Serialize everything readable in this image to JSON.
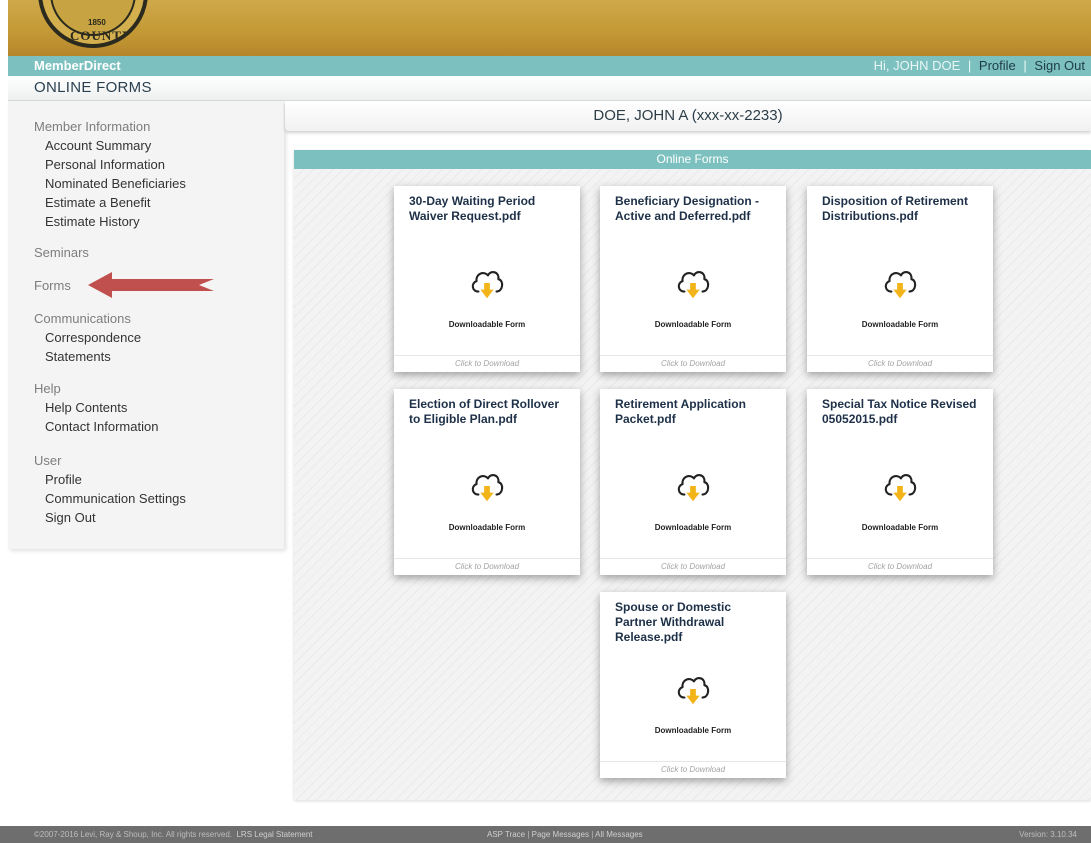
{
  "header": {
    "seal_year": "1850",
    "seal_text": "COUNTY",
    "brand": "MemberDirect",
    "greeting": "Hi, JOHN DOE",
    "profile_link": "Profile",
    "signout_link": "Sign Out",
    "separator": "|",
    "page_title": "ONLINE FORMS"
  },
  "sidebar": {
    "member_information": "Member Information",
    "member_items": [
      "Account Summary",
      "Personal Information",
      "Nominated Beneficiaries",
      "Estimate a Benefit",
      "Estimate History"
    ],
    "seminars": "Seminars",
    "forms": "Forms",
    "communications": "Communications",
    "communications_items": [
      "Correspondence",
      "Statements"
    ],
    "help": "Help",
    "help_items": [
      "Help Contents",
      "Contact Information"
    ],
    "user": "User",
    "user_items": [
      "Profile",
      "Communication Settings",
      "Sign Out"
    ]
  },
  "member": {
    "name": "DOE, JOHN A (xxx-xx-2233)"
  },
  "forms_panel": {
    "title": "Online Forms",
    "type_label": "Downloadable Form",
    "download_label": "Click to Download",
    "forms": [
      {
        "name": "30-Day Waiting Period Waiver Request.pdf"
      },
      {
        "name": "Beneficiary Designation - Active and Deferred.pdf"
      },
      {
        "name": "Disposition of Retirement Distributions.pdf"
      },
      {
        "name": "Election of Direct Rollover to Eligible Plan.pdf"
      },
      {
        "name": "Retirement Application Packet.pdf"
      },
      {
        "name": "Special Tax Notice Revised 05052015.pdf"
      },
      {
        "name": "Spouse or Domestic Partner Withdrawal Release.pdf"
      }
    ]
  },
  "colors": {
    "banner_gold": "#c49a36",
    "teal": "#7cc1bf",
    "arrow_red": "#c0504d",
    "download_yellow": "#f2b418",
    "footer_gray": "#6e6e6e"
  },
  "footer": {
    "copyright": "©2007-2016 Levi, Ray & Shoup, Inc. All rights reserved.",
    "legal": "LRS Legal Statement",
    "asp_trace": "ASP Trace",
    "page_messages": "Page Messages",
    "all_messages": "All Messages",
    "version": "Version: 3.10.34",
    "separator": "|"
  }
}
